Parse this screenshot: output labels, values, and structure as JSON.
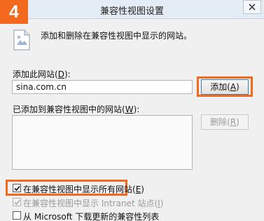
{
  "step_number": "4",
  "window": {
    "title": "兼容性视图设置",
    "close_symbol": "close-icon"
  },
  "intro_text": "添加和删除在兼容性视图中显示的网站。",
  "add_site": {
    "label": "添加此网站(",
    "label_key": "D",
    "label_end": "):",
    "value": "sina.com.cn",
    "button_label": "添加(",
    "button_key": "A",
    "button_end": ")"
  },
  "added_sites": {
    "label": "已添加到兼容性视图中的网站(",
    "label_key": "W",
    "label_end": "):",
    "items": [],
    "remove_label": "删除(",
    "remove_key": "R",
    "remove_end": ")"
  },
  "options": [
    {
      "label": "在兼容性视图中显示所有网站(",
      "key": "E",
      "end": ")",
      "checked": true,
      "enabled": true
    },
    {
      "label": "在兼容性视图中显示 Intranet 站点(",
      "key": "I",
      "end": ")",
      "checked": true,
      "enabled": false
    },
    {
      "label": "从 Microsoft 下载更新的兼容性列表",
      "key": "",
      "end": "",
      "checked": false,
      "enabled": true
    }
  ],
  "colors": {
    "highlight": "#f36a1f",
    "title_bar": "#e4ecf5"
  }
}
